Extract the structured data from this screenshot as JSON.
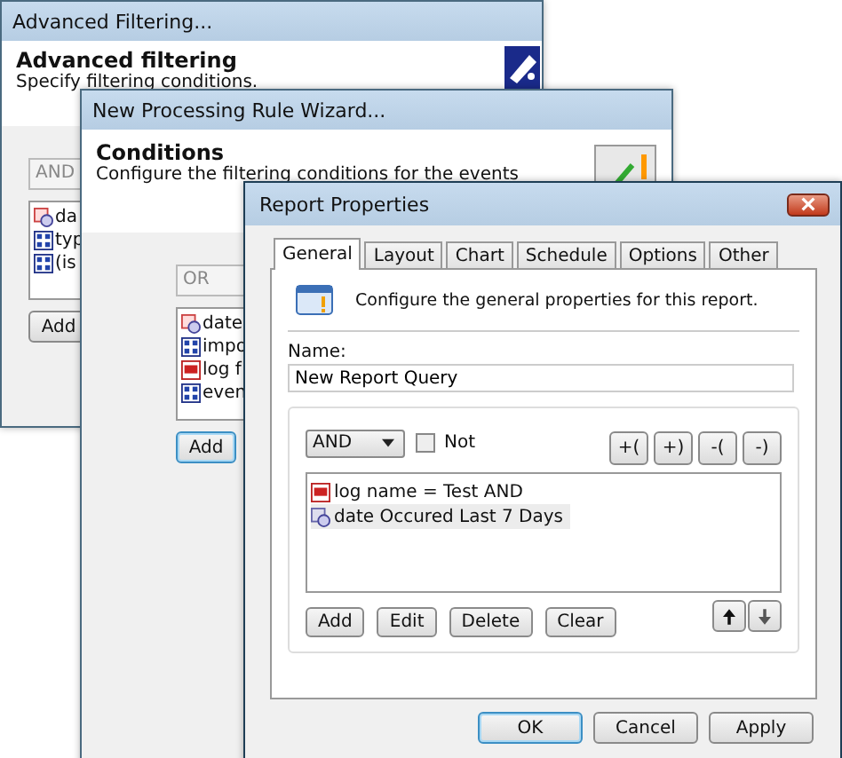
{
  "background_windows": [
    {
      "title": "Advanced Filtering...",
      "heading": "Advanced filtering",
      "subheading": "Specify filtering conditions.",
      "combo": "AND",
      "items": [
        {
          "kind": "date",
          "text": "da"
        },
        {
          "kind": "enum",
          "text": "typ"
        },
        {
          "kind": "enum",
          "text": "(is"
        }
      ],
      "button": "Add"
    },
    {
      "title": "New Processing Rule Wizard...",
      "heading": "Conditions",
      "subheading": "Configure the filtering conditions for the events",
      "combo": "OR",
      "items": [
        {
          "kind": "date",
          "text": "date"
        },
        {
          "kind": "enum",
          "text": "impo"
        },
        {
          "kind": "text",
          "text": "log f"
        },
        {
          "kind": "enum",
          "text": "even"
        }
      ],
      "button": "Add"
    }
  ],
  "dialog": {
    "title": "Report Properties",
    "tabs": [
      {
        "label": "General",
        "selected": true
      },
      {
        "label": "Layout",
        "selected": false
      },
      {
        "label": "Chart",
        "selected": false
      },
      {
        "label": "Schedule",
        "selected": false
      },
      {
        "label": "Options",
        "selected": false
      },
      {
        "label": "Other",
        "selected": false
      }
    ],
    "info": "Configure the general properties for this report.",
    "name_label": "Name:",
    "name_value": "New Report Query",
    "operator": "AND",
    "not_label": "Not",
    "not_checked": false,
    "paren_buttons": [
      "+(",
      "+)",
      "-(",
      "-)"
    ],
    "conditions": [
      {
        "kind": "text",
        "text": "log name = Test AND",
        "selected": false
      },
      {
        "kind": "date",
        "text": "date Occured Last 7 Days",
        "selected": true
      }
    ],
    "list_buttons": [
      "Add",
      "Edit",
      "Delete",
      "Clear"
    ],
    "footer_buttons": [
      "OK",
      "Cancel",
      "Apply"
    ]
  }
}
